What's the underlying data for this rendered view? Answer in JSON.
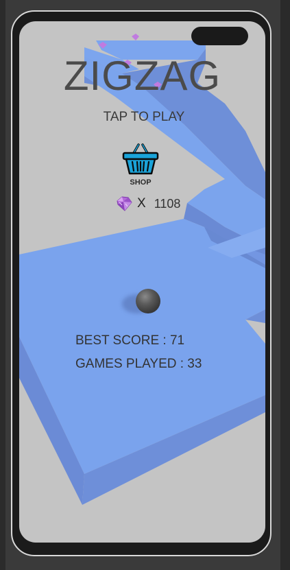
{
  "game": {
    "title": "ZIGZAG",
    "prompt": "TAP TO PLAY",
    "shop_label": "SHOP",
    "gem_multiplier": "X",
    "gem_count": "1108",
    "best_score_label": "BEST SCORE : 71",
    "games_played_label": "GAMES PLAYED : 33"
  },
  "colors": {
    "background": "#c4c4c4",
    "path_top": "#7ba4ed",
    "path_side": "#6f8fd8",
    "text": "#4b4b4b",
    "shop_icon": "#1aa3d9",
    "gem": "#b26ad8"
  },
  "icons": [
    "shop-basket-icon",
    "gem-icon"
  ]
}
